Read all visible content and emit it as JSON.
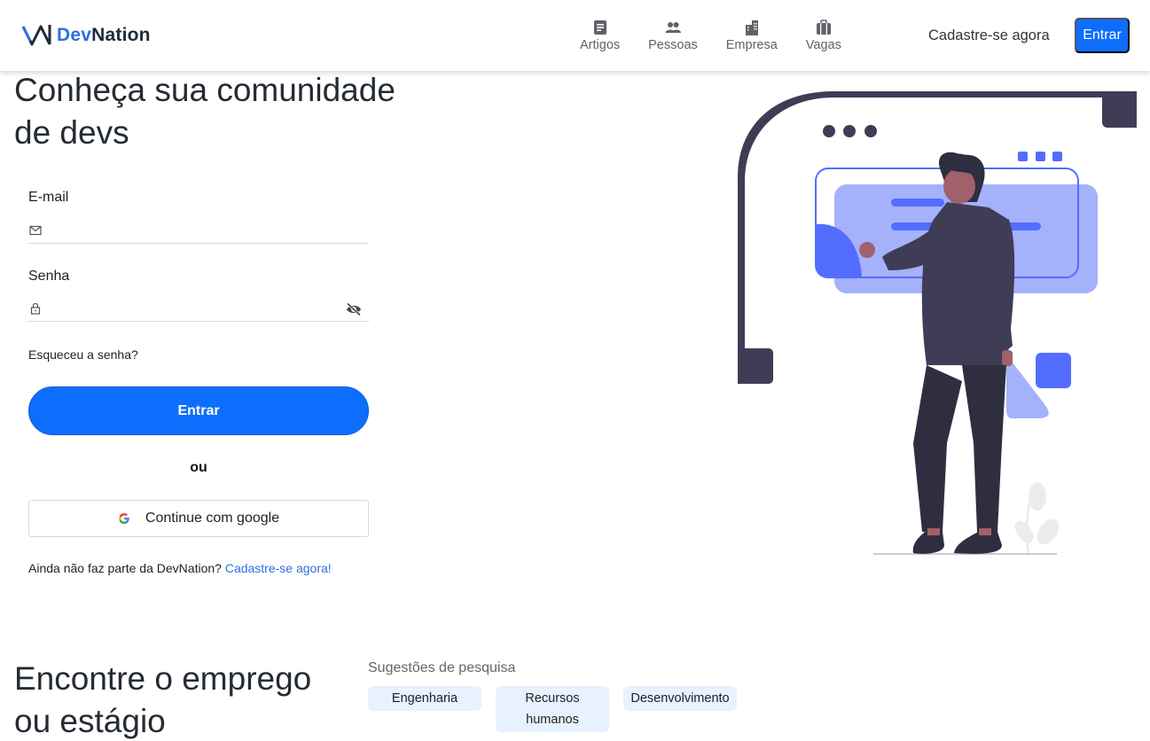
{
  "header": {
    "logo": {
      "part1": "Dev",
      "part2": "Nation"
    },
    "nav": [
      {
        "label": "Artigos",
        "icon": "article-icon"
      },
      {
        "label": "Pessoas",
        "icon": "people-icon"
      },
      {
        "label": "Empresa",
        "icon": "building-icon"
      },
      {
        "label": "Vagas",
        "icon": "briefcase-icon"
      }
    ],
    "signup_label": "Cadastre-se agora",
    "login_label": "Entrar"
  },
  "hero": {
    "title": "Conheça sua comunidade de devs",
    "email_label": "E-mail",
    "email_value": "",
    "password_label": "Senha",
    "password_value": "",
    "forgot": "Esqueceu a senha?",
    "submit": "Entrar",
    "or": "ou",
    "google": "Continue com google",
    "join_text": "Ainda não faz parte da DevNation?",
    "join_link": "Cadastre-se agora!"
  },
  "section2": {
    "title": "Encontre o emprego ou estágio",
    "suggestions_title": "Sugestões de pesquisa",
    "chips": [
      "Engenharia",
      "Recursos humanos",
      "Desenvolvimento"
    ]
  },
  "colors": {
    "primary": "#0d6efd",
    "brand_blue": "#2f6fe0",
    "illustration_accent": "#536dfe",
    "illustration_light": "#a5b1fa",
    "illustration_dark": "#3f3d56",
    "chip_bg": "#e7f1ff"
  }
}
